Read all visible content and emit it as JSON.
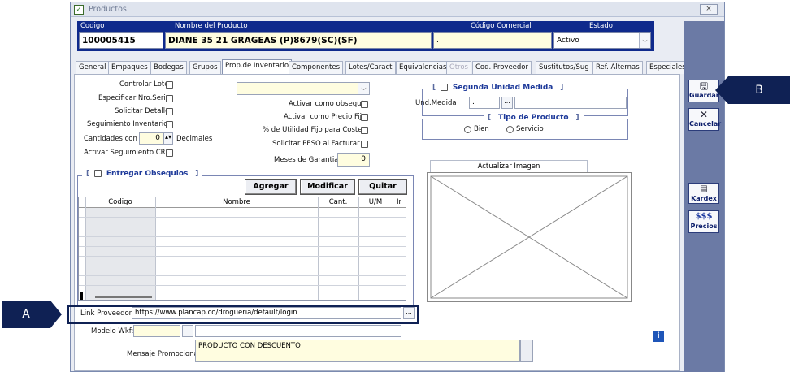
{
  "window": {
    "title": "Productos",
    "close_label": "⨯"
  },
  "header": {
    "codigo_label": "Codigo",
    "nombre_label": "Nombre del Producto",
    "codigo_comercial_label": "Código Comercial",
    "estado_label": "Estado",
    "codigo_value": "100005415",
    "nombre_value": "DIANE 35 21 GRAGEAS (P)8679(SC)(SF)",
    "codigo_comercial_value": ".",
    "estado_value": "Activo"
  },
  "tabs": [
    "General",
    "Empaques",
    "Bodegas",
    "Grupos",
    "Prop.de Inventario",
    "Componentes",
    "Lotes/Caract",
    "Equivalencias",
    "Otros",
    "Cod. Proveedor",
    "Sustitutos/Sug",
    "Ref. Alternas",
    "Especiales"
  ],
  "active_tab": "Prop.de Inventario",
  "inventory": {
    "controlar_lote": "Controlar Lote",
    "especificar_serie": "Especificar Nro.Serie",
    "solicitar_detalle": "Solicitar Detalle",
    "seguimiento_inventario": "Seguimiento Inventario",
    "cantidades_con": "Cantidades con",
    "decimales_value": "0",
    "decimales_label": "Decimales",
    "activar_crm": "Activar Seguimiento CRM",
    "activar_obsequio": "Activar como obsequio",
    "activar_precio_fijo": "Activar como Precio Fijo",
    "utilidad_fijo": "% de Utilidad Fijo para Costeo",
    "solicitar_peso": "Solicitar  PESO  al  Facturar",
    "meses_garantia": "Meses de Garantia",
    "meses_garantia_value": "0"
  },
  "segunda_unidad": {
    "title": "Segunda Unidad Medida",
    "und_medida_label": "Und.Medida",
    "und_medida_value": "."
  },
  "tipo_producto": {
    "title": "Tipo de Producto",
    "bien": "Bien",
    "servicio": "Servicio"
  },
  "obsequios": {
    "title": "Entregar Obsequios",
    "agregar": "Agregar",
    "modificar": "Modificar",
    "quitar": "Quitar",
    "columns": [
      "Codigo",
      "Nombre",
      "Cant.",
      "U/M",
      "Ir"
    ]
  },
  "imagen": {
    "actualizar": "Actualizar Imagen"
  },
  "bottom": {
    "link_label": "Link Proveedor",
    "link_value": "https://www.plancap.co/drogueria/default/login",
    "modelo_label": "Modelo Wkf:",
    "mensaje_label": "Mensaje Promocional",
    "mensaje_value": "PRODUCTO CON DESCUENTO",
    "ellipsis": "..."
  },
  "side_buttons": {
    "guardar": "Guardar",
    "cancelar": "Cancelar",
    "kardex": "Kardex",
    "precios_top": "$$$",
    "precios": "Precios"
  },
  "info_badge": "i",
  "callouts": {
    "a": "A",
    "b": "B"
  },
  "colors": {
    "header_band": "#0f2a8c",
    "callout": "#0f2154",
    "yellow_field": "#fffde0"
  }
}
